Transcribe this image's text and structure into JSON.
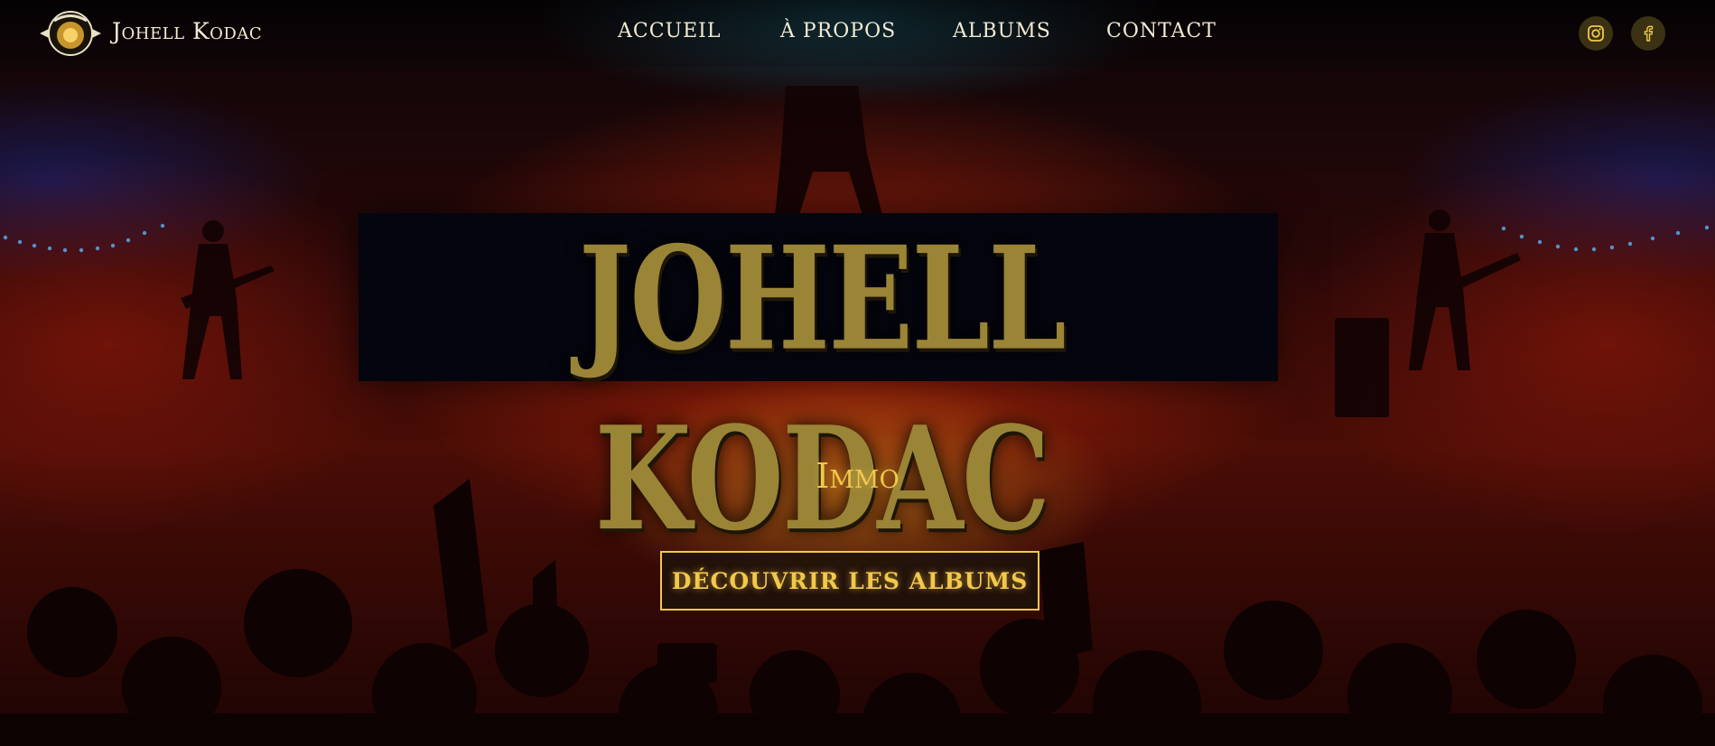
{
  "header": {
    "brand": "Johell Kodac",
    "logo_icon": "band-logo-icon",
    "nav": [
      {
        "label": "ACCUEIL"
      },
      {
        "label": "À PROPOS"
      },
      {
        "label": "ALBUMS"
      },
      {
        "label": "CONTACT"
      }
    ],
    "social": [
      {
        "icon": "instagram-icon"
      },
      {
        "icon": "facebook-icon"
      }
    ]
  },
  "hero": {
    "title": "JOHELL KODAC",
    "subtitle": "Immo",
    "cta_label": "DÉCOUVRIR LES ALBUMS",
    "background": "concert-crowd-image"
  },
  "colors": {
    "accent": "#f1c84a",
    "title_gold": "#9a8436",
    "nav_text": "#f3ead3",
    "social_bg": "#3a3212"
  }
}
